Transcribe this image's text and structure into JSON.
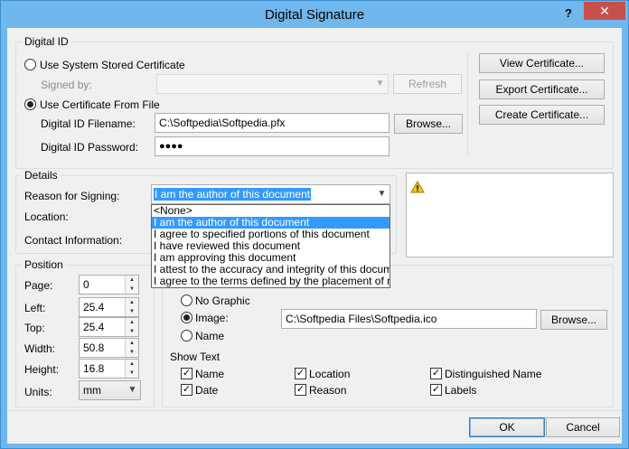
{
  "window": {
    "title": "Digital Signature",
    "help": "?",
    "close": "✕"
  },
  "digital_id": {
    "group": "Digital ID",
    "use_system": "Use System Stored Certificate",
    "signed_by_label": "Signed by:",
    "signed_by_value": "",
    "refresh": "Refresh",
    "use_file": "Use Certificate From File",
    "filename_label": "Digital ID Filename:",
    "filename_value": "C:\\Softpedia\\Softpedia.pfx",
    "browse": "Browse...",
    "password_label": "Digital ID Password:",
    "password_value": "●●●●",
    "view_cert": "View Certificate...",
    "export_cert": "Export Certificate...",
    "create_cert": "Create Certificate..."
  },
  "details": {
    "group": "Details",
    "reason_label": "Reason for Signing:",
    "reason_value": "I am the author of this document",
    "location_label": "Location:",
    "contact_label": "Contact Information:",
    "options": [
      "<None>",
      "I am the author of this document",
      "I agree to specified portions of this document",
      "I have reviewed this document",
      "I am approving this document",
      "I attest to the accuracy and integrity of this document",
      "I agree to the terms defined by the placement of my signature"
    ]
  },
  "position": {
    "group": "Position",
    "page_label": "Page:",
    "page_value": "0",
    "left_label": "Left:",
    "left_value": "25.4",
    "top_label": "Top:",
    "top_value": "25.4",
    "width_label": "Width:",
    "width_value": "50.8",
    "height_label": "Height:",
    "height_value": "16.8",
    "units_label": "Units:",
    "units_value": "mm"
  },
  "appearance": {
    "no_graphic": "No Graphic",
    "image": "Image:",
    "image_path": "C:\\Softpedia Files\\Softpedia.ico",
    "browse": "Browse...",
    "name": "Name",
    "show_text": "Show Text",
    "chk_name": "Name",
    "chk_date": "Date",
    "chk_location": "Location",
    "chk_reason": "Reason",
    "chk_dn": "Distinguished Name",
    "chk_labels": "Labels"
  },
  "footer": {
    "ok": "OK",
    "cancel": "Cancel"
  }
}
